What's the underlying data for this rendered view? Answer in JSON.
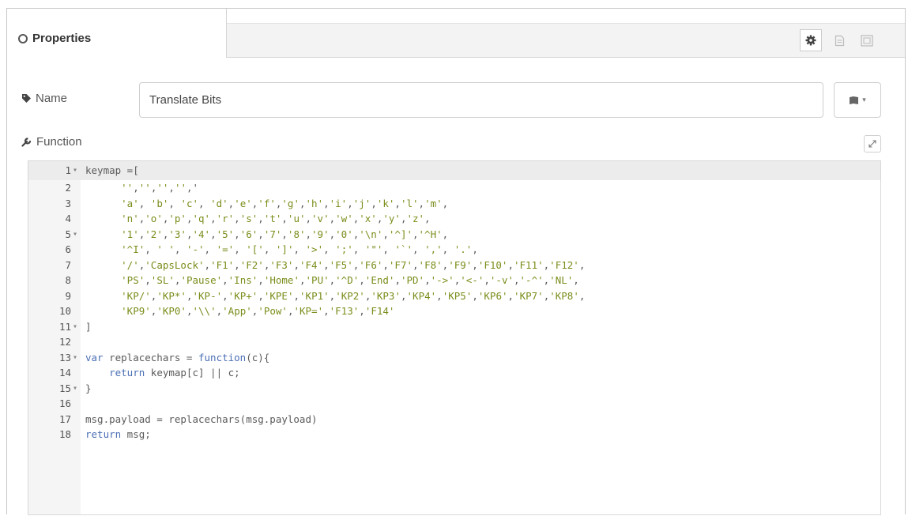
{
  "tab": {
    "label": "Properties"
  },
  "toolbar": {
    "buttons": [
      {
        "icon": "gear-icon"
      },
      {
        "icon": "document-icon"
      },
      {
        "icon": "layout-icon"
      }
    ]
  },
  "name_row": {
    "label": "Name",
    "value": "Translate Bits",
    "icon_select": "book-icon"
  },
  "function_row": {
    "label": "Function"
  },
  "colors": {
    "string": "#7a8d1a",
    "keyword": "#4b6fb5",
    "text": "#5a5a5a"
  },
  "code": [
    {
      "n": "1",
      "fold": "▾",
      "text": "keymap =["
    },
    {
      "n": "2",
      "fold": "",
      "text": "      '','','','','"
    },
    {
      "n": "3",
      "fold": "",
      "text": "      'a', 'b', 'c', 'd','e','f','g','h','i','j','k','l','m',"
    },
    {
      "n": "4",
      "fold": "",
      "text": "      'n','o','p','q','r','s','t','u','v','w','x','y','z',"
    },
    {
      "n": "5",
      "fold": "▾",
      "text": "      '1','2','3','4','5','6','7','8','9','0','\\n','^]','^H',"
    },
    {
      "n": "6",
      "fold": "",
      "text": "      '^I', ' ', '-', '=', '[', ']', '>', ';', '\"', '`', ',', '.',"
    },
    {
      "n": "7",
      "fold": "",
      "text": "      '/','CapsLock','F1','F2','F3','F4','F5','F6','F7','F8','F9','F10','F11','F12',"
    },
    {
      "n": "8",
      "fold": "",
      "text": "      'PS','SL','Pause','Ins','Home','PU','^D','End','PD','->','<-','-v','-^','NL',"
    },
    {
      "n": "9",
      "fold": "",
      "text": "      'KP/','KP*','KP-','KP+','KPE','KP1','KP2','KP3','KP4','KP5','KP6','KP7','KP8',"
    },
    {
      "n": "10",
      "fold": "",
      "text": "      'KP9','KP0','\\\\','App','Pow','KP=','F13','F14'"
    },
    {
      "n": "11",
      "fold": "▾",
      "text": "]"
    },
    {
      "n": "12",
      "fold": "",
      "text": ""
    },
    {
      "n": "13",
      "fold": "▾",
      "text": "var replacechars = function(c){"
    },
    {
      "n": "14",
      "fold": "",
      "text": "    return keymap[c] || c;"
    },
    {
      "n": "15",
      "fold": "▾",
      "text": "}"
    },
    {
      "n": "16",
      "fold": "",
      "text": ""
    },
    {
      "n": "17",
      "fold": "",
      "text": "msg.payload = replacechars(msg.payload)"
    },
    {
      "n": "18",
      "fold": "",
      "text": "return msg;"
    }
  ]
}
